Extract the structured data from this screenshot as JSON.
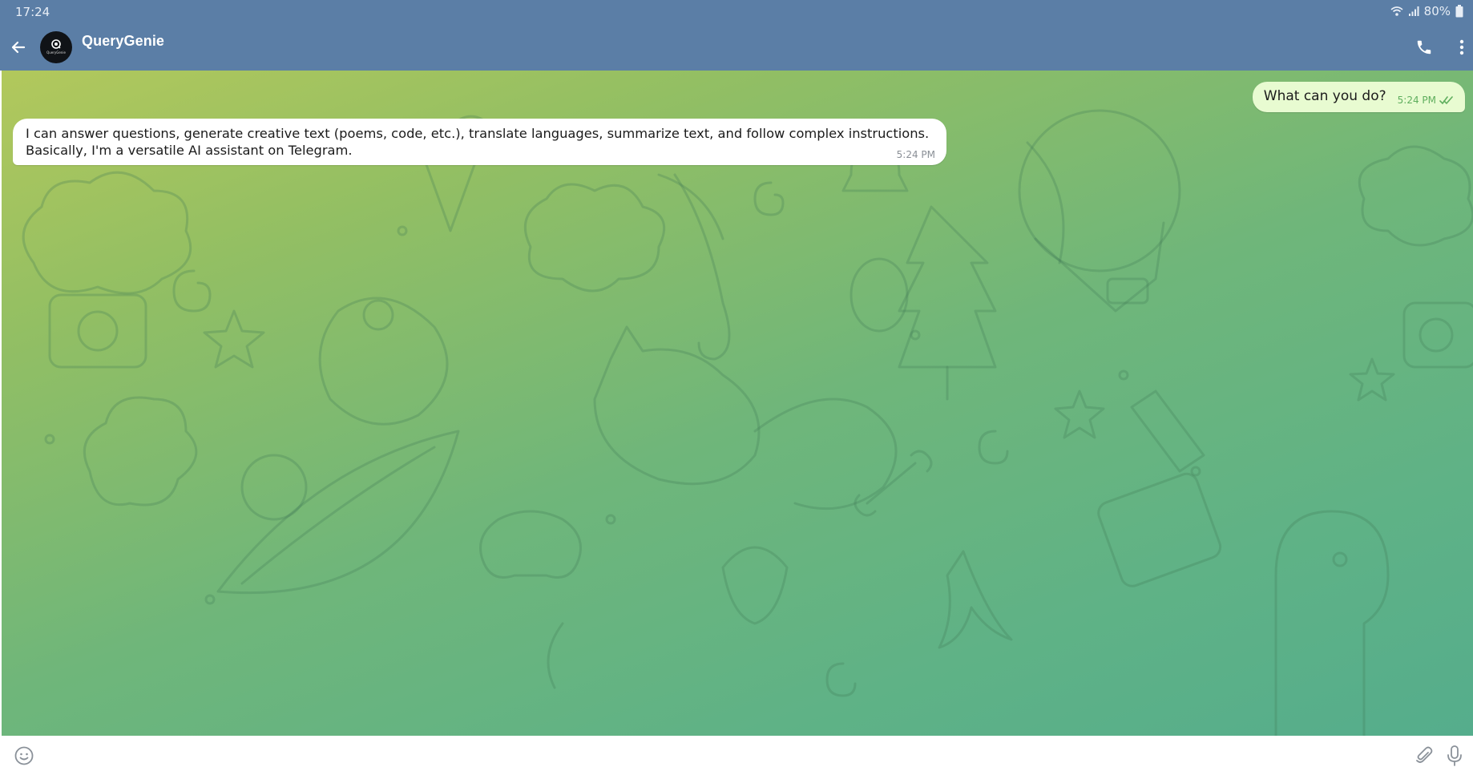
{
  "status_bar": {
    "time": "17:24",
    "battery_percent": "80%",
    "icons": [
      "wifi-icon",
      "signal-icon",
      "battery-icon"
    ]
  },
  "header": {
    "chat_name": "QueryGenie",
    "avatar_logo_text": "QueryGenie",
    "icons": [
      "back-arrow-icon",
      "phone-icon",
      "more-vertical-icon"
    ]
  },
  "messages": [
    {
      "direction": "outgoing",
      "text": "What can you do?",
      "time": "5:24 PM",
      "status_icon": "double-check-icon"
    },
    {
      "direction": "incoming",
      "text": "I can answer questions, generate creative text (poems, code, etc.), translate languages, summarize text, and follow complex instructions.\nBasically, I'm a versatile AI assistant on Telegram.",
      "time": "5:24 PM"
    }
  ],
  "input_bar": {
    "value": "",
    "placeholder": "",
    "icons": [
      "emoji-icon",
      "paperclip-icon",
      "microphone-icon"
    ]
  },
  "colors": {
    "header": "#5b7ea6",
    "outgoing_bubble": "#e8fbd1",
    "incoming_bubble": "#ffffff",
    "wallpaper_top": "#b2c85c",
    "wallpaper_bottom": "#55ad8c",
    "read_check": "#5fae5e"
  }
}
